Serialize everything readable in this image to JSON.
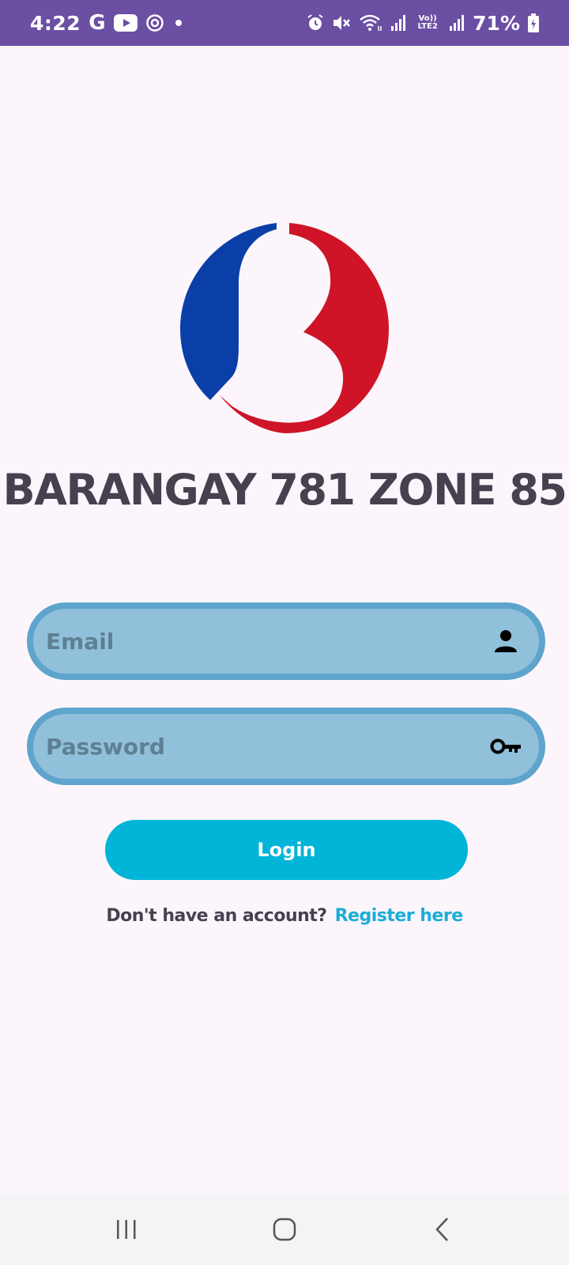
{
  "status_bar": {
    "time": "4:22",
    "g_label": "G",
    "lte_label": "Vo)) LTE2",
    "battery": "71%",
    "bg_color": "#6a4fa3",
    "icons": [
      "google-icon",
      "youtube-icon",
      "sync-icon",
      "dot-icon",
      "alarm-icon",
      "mute-icon",
      "wifi-icon",
      "signal-icon",
      "battery-icon"
    ]
  },
  "app": {
    "title": "BARANGAY 781 ZONE 85",
    "logo_colors": {
      "blue": "#0a3fa8",
      "red": "#cf1428"
    }
  },
  "login_form": {
    "email_placeholder": "Email",
    "email_value": "",
    "email_icon": "person-icon",
    "password_placeholder": "Password",
    "password_value": "",
    "password_icon": "key-icon",
    "login_label": "Login",
    "register_prompt": "Don't have an account?",
    "register_link": "Register here",
    "accent_color": "#00b5d8",
    "field_color": "#90c0da"
  },
  "nav_bar": {
    "buttons": [
      "recents-icon",
      "home-icon",
      "back-icon"
    ]
  }
}
